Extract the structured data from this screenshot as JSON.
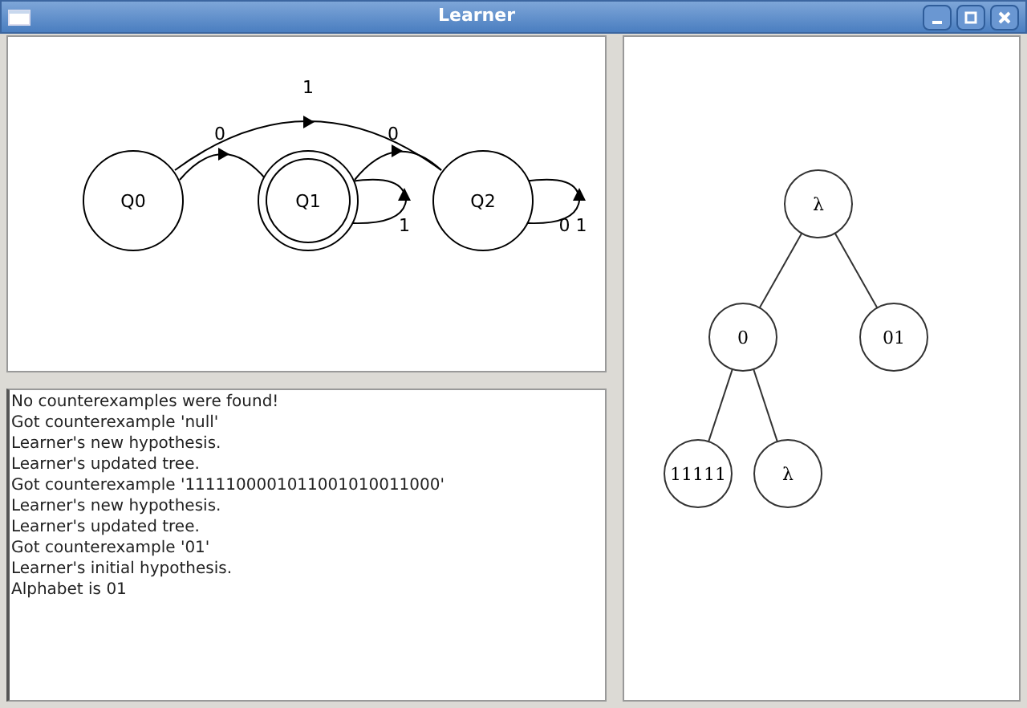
{
  "window": {
    "title": "Learner"
  },
  "automaton": {
    "states": [
      {
        "label": "Q0",
        "accepting": false
      },
      {
        "label": "Q1",
        "accepting": true
      },
      {
        "label": "Q2",
        "accepting": false
      }
    ],
    "transitions": [
      {
        "kind": "arc",
        "label": "1"
      },
      {
        "kind": "arc",
        "label": "0"
      },
      {
        "kind": "arc",
        "label": "0"
      },
      {
        "kind": "loop",
        "label": "1"
      },
      {
        "kind": "loop",
        "label": "0 1"
      }
    ]
  },
  "log": [
    "No counterexamples were found!",
    "Got counterexample 'null'",
    "Learner's new hypothesis.",
    "Learner's updated tree.",
    "Got counterexample '1111100001011001010011000'",
    "Learner's new hypothesis.",
    "Learner's updated tree.",
    "Got counterexample '01'",
    "Learner's initial hypothesis.",
    "Alphabet is 01"
  ],
  "tree": {
    "label": "λ",
    "children": [
      {
        "label": "0",
        "children": [
          {
            "label": "11111"
          },
          {
            "label": "λ"
          }
        ]
      },
      {
        "label": "01"
      }
    ]
  }
}
